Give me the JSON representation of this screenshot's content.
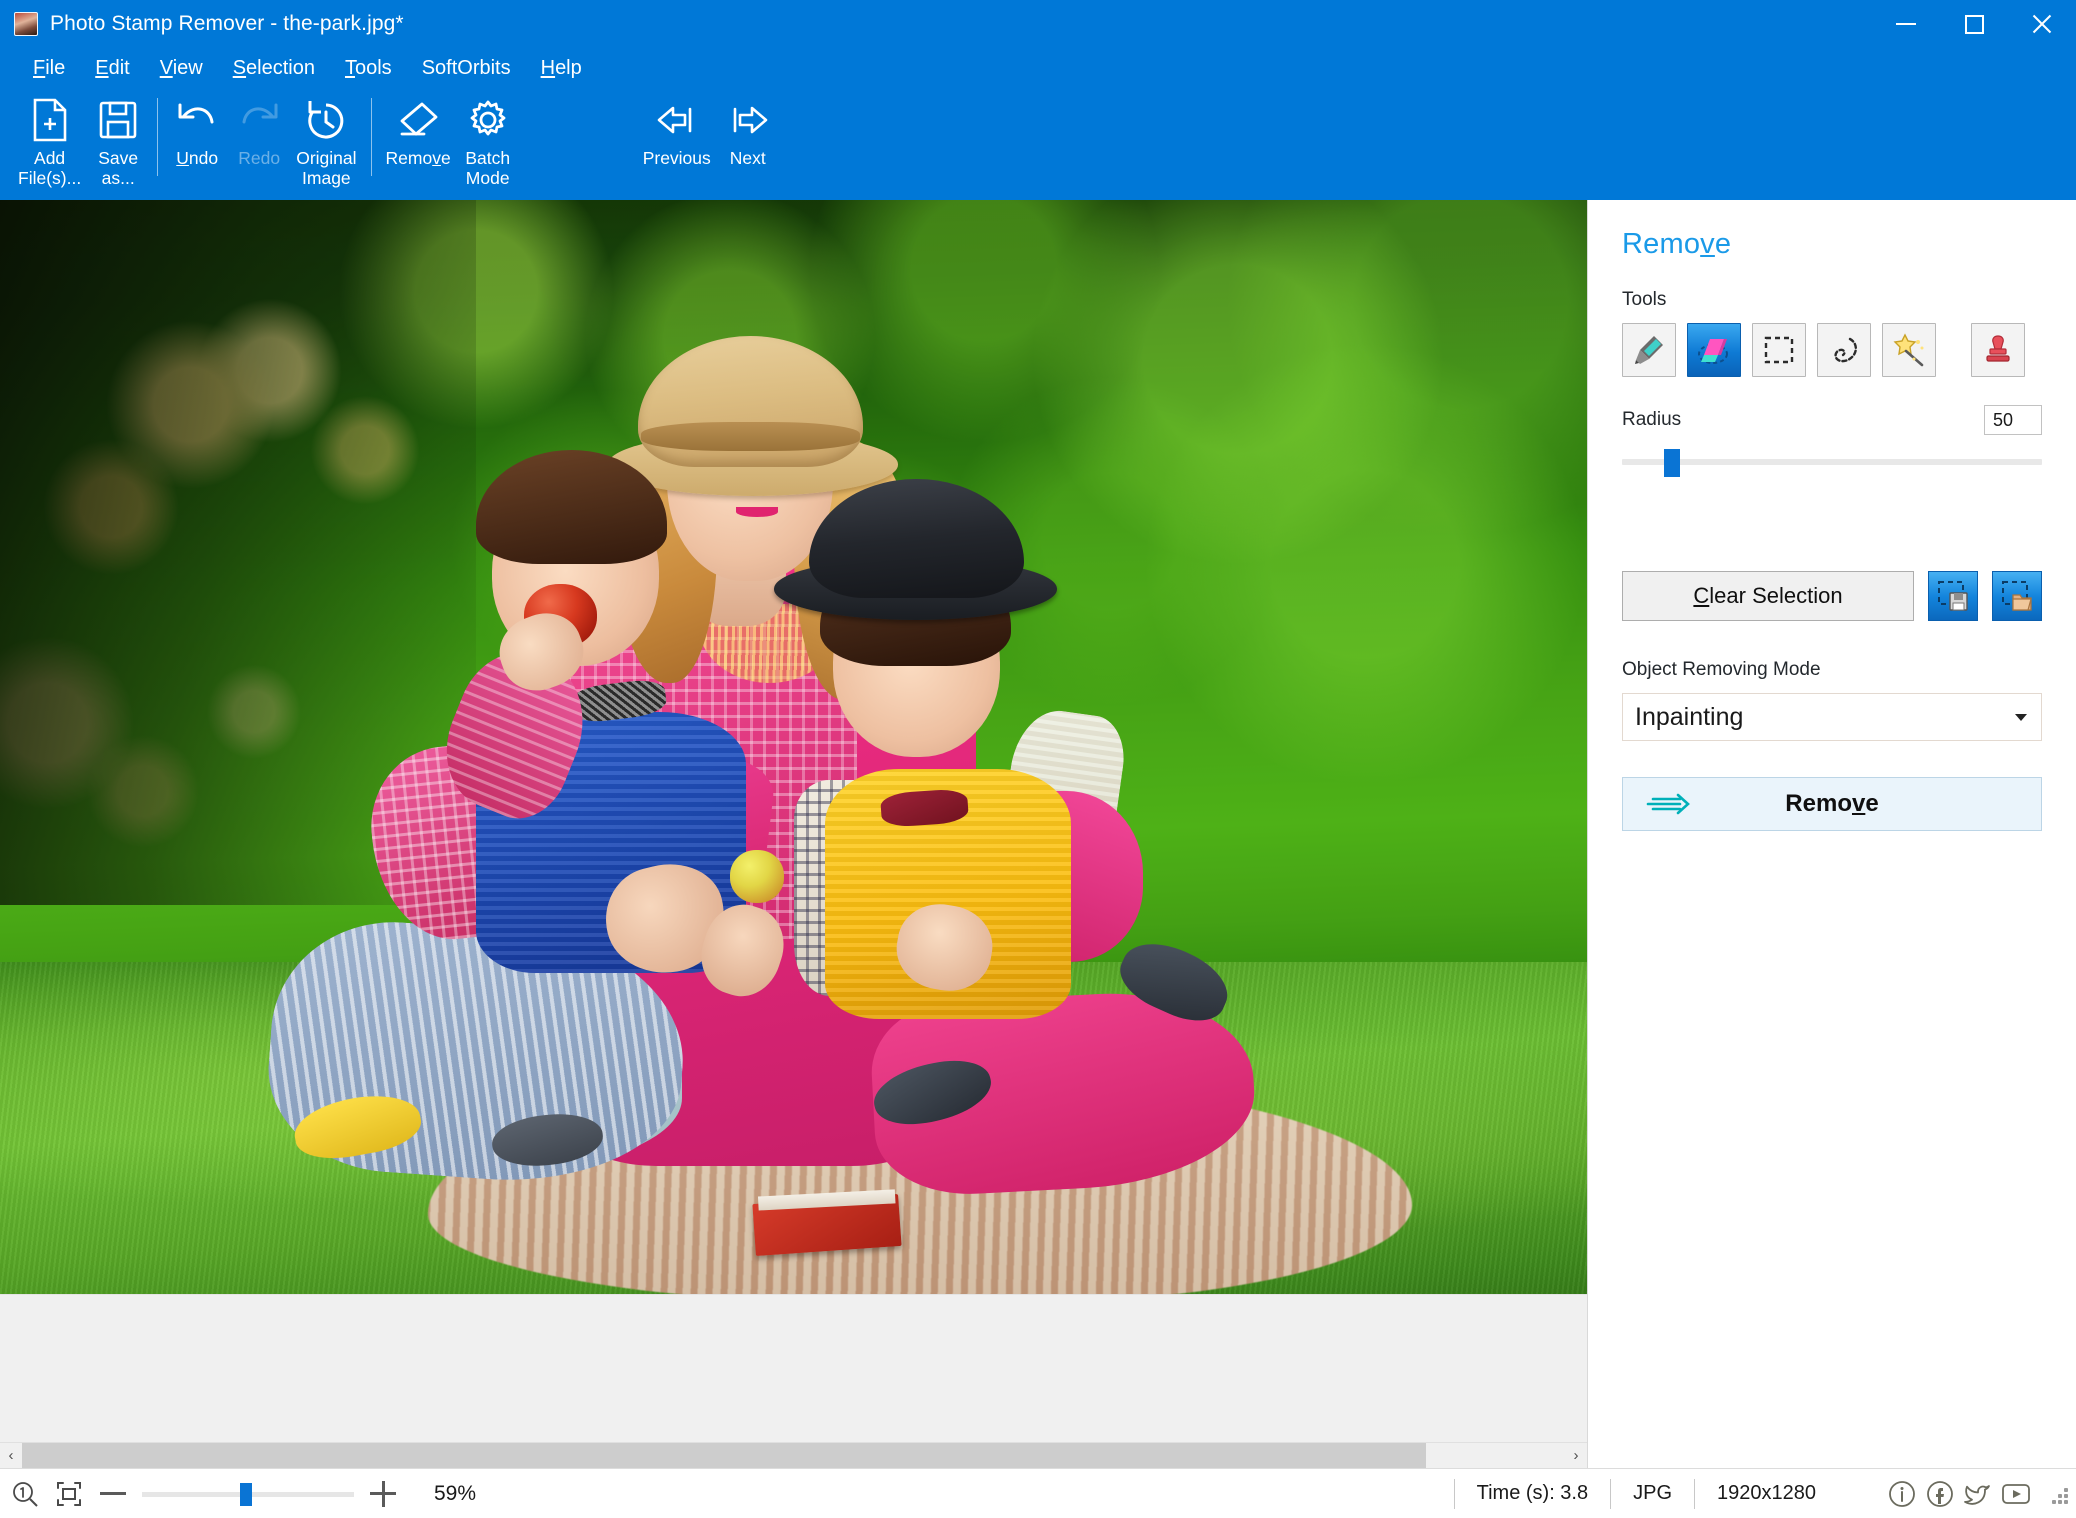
{
  "window": {
    "title": "Photo Stamp Remover - the-park.jpg*",
    "app_icon": "app-photo-icon",
    "minimize": "minimize-icon",
    "maximize": "maximize-icon",
    "close": "close-icon"
  },
  "menu": {
    "items": [
      {
        "label": "File",
        "accel": "F"
      },
      {
        "label": "Edit",
        "accel": "E"
      },
      {
        "label": "View",
        "accel": "V"
      },
      {
        "label": "Selection",
        "accel": "S"
      },
      {
        "label": "Tools",
        "accel": "T"
      },
      {
        "label": "SoftOrbits",
        "accel": ""
      },
      {
        "label": "Help",
        "accel": "H"
      }
    ]
  },
  "toolbar": {
    "buttons": [
      {
        "label": "Add\nFile(s)...",
        "icon": "add-file-icon",
        "disabled": false
      },
      {
        "label": "Save\nas...",
        "icon": "save-as-icon",
        "disabled": false
      },
      {
        "label": "Undo",
        "icon": "undo-icon",
        "disabled": false
      },
      {
        "label": "Redo",
        "icon": "redo-icon",
        "disabled": true
      },
      {
        "label": "Original\nImage",
        "icon": "original-image-icon",
        "disabled": false
      },
      {
        "label": "Remove",
        "icon": "remove-eraser-icon",
        "disabled": false
      },
      {
        "label": "Batch\nMode",
        "icon": "batch-mode-gear-icon",
        "disabled": false
      },
      {
        "label": "Previous",
        "icon": "previous-arrow-icon",
        "disabled": false
      },
      {
        "label": "Next",
        "icon": "next-arrow-icon",
        "disabled": false
      }
    ]
  },
  "panel": {
    "title": "Remove",
    "tools_label": "Tools",
    "tools": [
      {
        "name": "marker-tool",
        "selected": false
      },
      {
        "name": "eraser-tool",
        "selected": true
      },
      {
        "name": "rectangle-select-tool",
        "selected": false
      },
      {
        "name": "lasso-select-tool",
        "selected": false
      },
      {
        "name": "magic-wand-tool",
        "selected": false
      },
      {
        "name": "stamp-tool",
        "selected": false
      }
    ],
    "radius_label": "Radius",
    "radius_value": "50",
    "clear_selection_label": "Clear Selection",
    "save_selection_icon": "save-selection-icon",
    "load_selection_icon": "load-selection-icon",
    "mode_label": "Object Removing Mode",
    "mode_value": "Inpainting",
    "remove_button_label": "Remove",
    "remove_button_arrow": "arrow-right-icon"
  },
  "statusbar": {
    "zoom_actual_icon": "zoom-actual-size-icon",
    "zoom_fit_icon": "zoom-fit-to-window-icon",
    "zoom_out_icon": "zoom-out-icon",
    "zoom_in_icon": "zoom-in-icon",
    "zoom_percent": "59%",
    "time_label": "Time (s): 3.8",
    "format": "JPG",
    "dimensions": "1920x1280",
    "social": [
      {
        "name": "info-icon"
      },
      {
        "name": "facebook-icon"
      },
      {
        "name": "twitter-icon"
      },
      {
        "name": "youtube-icon"
      }
    ]
  },
  "scrollbar": {
    "left_arrow": "scroll-left-arrow",
    "right_arrow": "scroll-right-arrow"
  },
  "canvas": {
    "photo_description": "the-park.jpg"
  },
  "colors": {
    "titlebar": "#0078D7",
    "panel_title": "#1A9AE8",
    "accent_slider": "#0A74D4",
    "remove_button_bg": "#EAF4FB"
  }
}
